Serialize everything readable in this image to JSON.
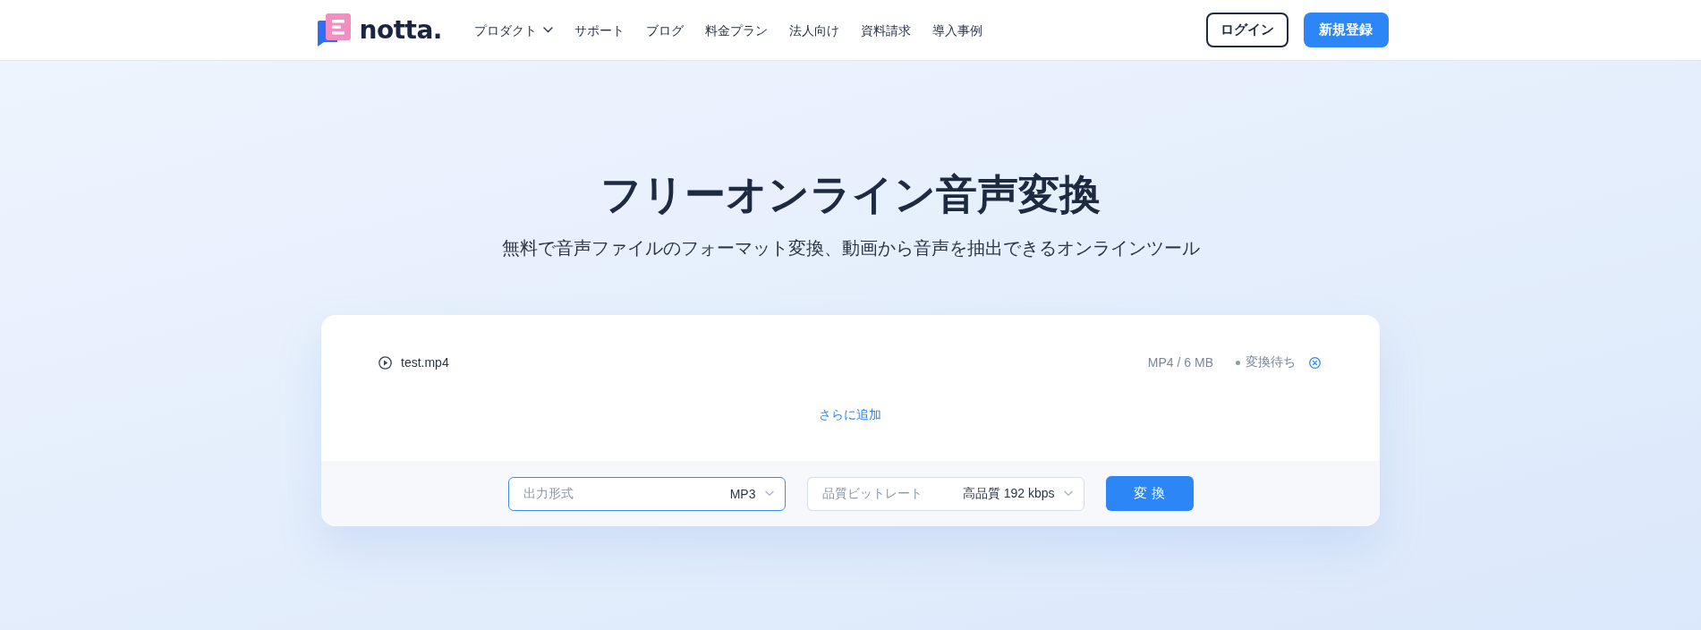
{
  "header": {
    "logo": {
      "text": "notta."
    },
    "nav": [
      {
        "label": "プロダクト",
        "kind": "dropdown"
      },
      {
        "label": "サポート",
        "kind": "link"
      },
      {
        "label": "ブログ",
        "kind": "link"
      },
      {
        "label": "料金プラン",
        "kind": "link"
      },
      {
        "label": "法人向け",
        "kind": "link"
      },
      {
        "label": "資料請求",
        "kind": "link"
      },
      {
        "label": "導入事例",
        "kind": "link"
      }
    ],
    "buttons": [
      {
        "label": "ログイン",
        "kind": "outline"
      },
      {
        "label": "新規登録",
        "kind": "primary"
      }
    ]
  },
  "hero": {
    "title": "フリーオンライン音声変換",
    "subtitle": "無料で音声ファイルのフォーマット変換、動画から音声を抽出できるオンラインツール"
  },
  "converter": {
    "files": [
      {
        "name": "test.mp4",
        "info": "MP4 / 6 MB",
        "status": "変換待ち"
      }
    ],
    "add_more": "さらに追加",
    "options": [
      {
        "label": "出力形式",
        "value": "MP3",
        "focused": true
      },
      {
        "label": "品質ビットレート",
        "value": "高品質 192 kbps",
        "focused": false
      }
    ],
    "convert_button": "変換"
  }
}
